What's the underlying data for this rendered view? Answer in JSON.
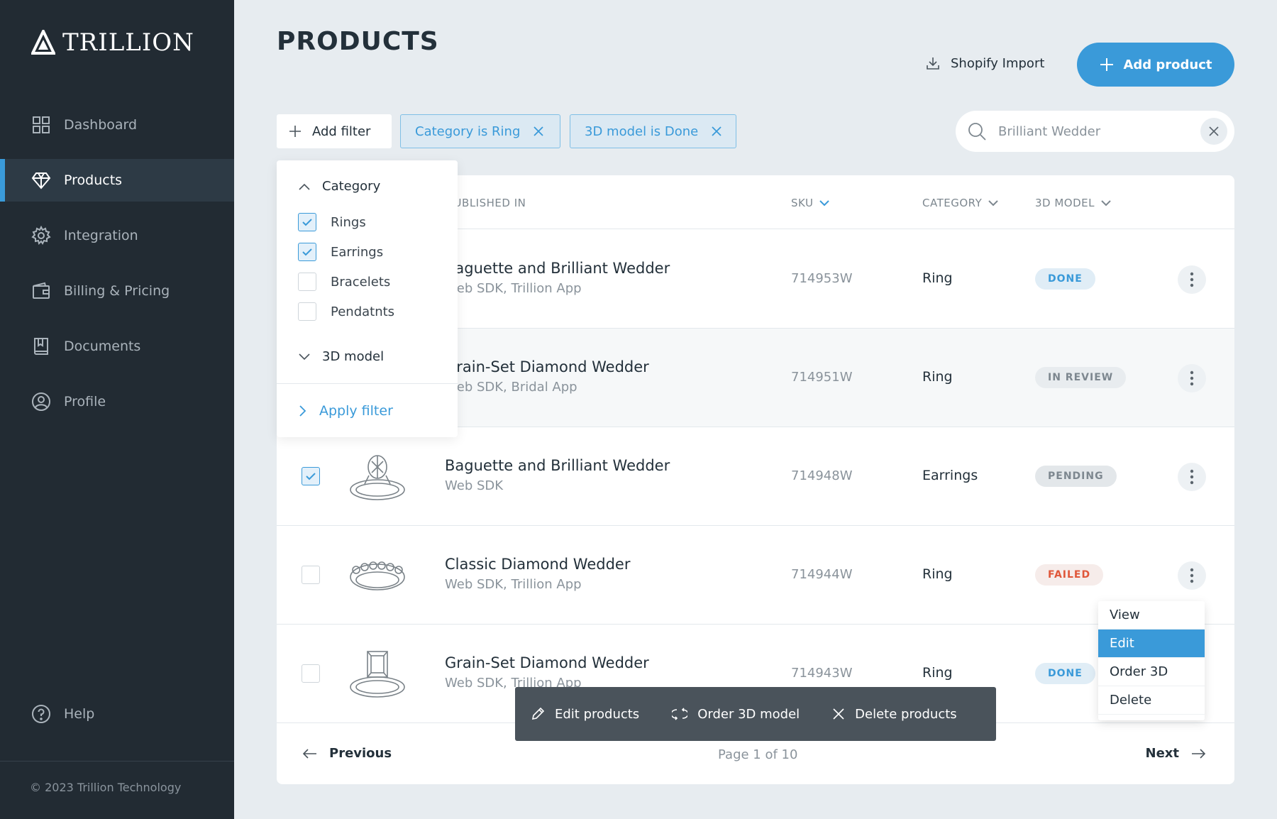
{
  "brand": {
    "name": "TRILLION"
  },
  "sidebar": {
    "items": [
      {
        "label": "Dashboard",
        "icon": "grid-icon"
      },
      {
        "label": "Products",
        "icon": "diamond-icon",
        "active": true
      },
      {
        "label": "Integration",
        "icon": "gear-icon"
      },
      {
        "label": "Billing & Pricing",
        "icon": "wallet-icon"
      },
      {
        "label": "Documents",
        "icon": "book-icon"
      },
      {
        "label": "Profile",
        "icon": "user-icon"
      }
    ],
    "help": "Help",
    "copyright": "© 2023 Trillion Technology"
  },
  "header": {
    "title": "PRODUCTS",
    "shopify_import": "Shopify Import",
    "add_product": "Add product"
  },
  "filters": {
    "add_filter": "Add filter",
    "chips": [
      "Category is Ring",
      "3D model is Done"
    ]
  },
  "search": {
    "value": "Brilliant Wedder"
  },
  "table": {
    "columns": {
      "published": "PUBLISHED IN",
      "sku": "SKU",
      "category": "CATEGORY",
      "model": "3D MODEL"
    },
    "rows": [
      {
        "name": "Baguette and Brilliant Wedder",
        "published": "Web SDK, Trillion App",
        "sku": "714953W",
        "category": "Ring",
        "status": "DONE",
        "checked": false
      },
      {
        "name": "Grain-Set Diamond Wedder",
        "published": "Web SDK, Bridal App",
        "sku": "714951W",
        "category": "Ring",
        "status": "IN REVIEW",
        "checked": false
      },
      {
        "name": "Baguette and Brilliant Wedder",
        "published": "Web SDK",
        "sku": "714948W",
        "category": "Earrings",
        "status": "PENDING",
        "checked": true
      },
      {
        "name": "Classic Diamond Wedder",
        "published": "Web SDK, Trillion App",
        "sku": "714944W",
        "category": "Ring",
        "status": "FAILED",
        "checked": false
      },
      {
        "name": "Grain-Set Diamond Wedder",
        "published": "Web SDK, Trillion App",
        "sku": "714943W",
        "category": "Ring",
        "status": "DONE",
        "checked": false
      }
    ]
  },
  "pager": {
    "previous": "Previous",
    "info": "Page 1 of 10",
    "next": "Next"
  },
  "filter_panel": {
    "category_label": "Category",
    "options": [
      {
        "label": "Rings",
        "checked": true
      },
      {
        "label": "Earrings",
        "checked": true
      },
      {
        "label": "Bracelets",
        "checked": false
      },
      {
        "label": "Pendatnts",
        "checked": false
      }
    ],
    "model_label": "3D model",
    "apply": "Apply filter"
  },
  "bulk_actions": {
    "edit": "Edit products",
    "order": "Order 3D model",
    "delete": "Delete products"
  },
  "context_menu": {
    "items": [
      "View",
      "Edit",
      "Order 3D",
      "Delete"
    ],
    "active_index": 1
  },
  "colors": {
    "accent": "#3a9ad9",
    "sidebar": "#222b33",
    "failed": "#e0573a"
  }
}
